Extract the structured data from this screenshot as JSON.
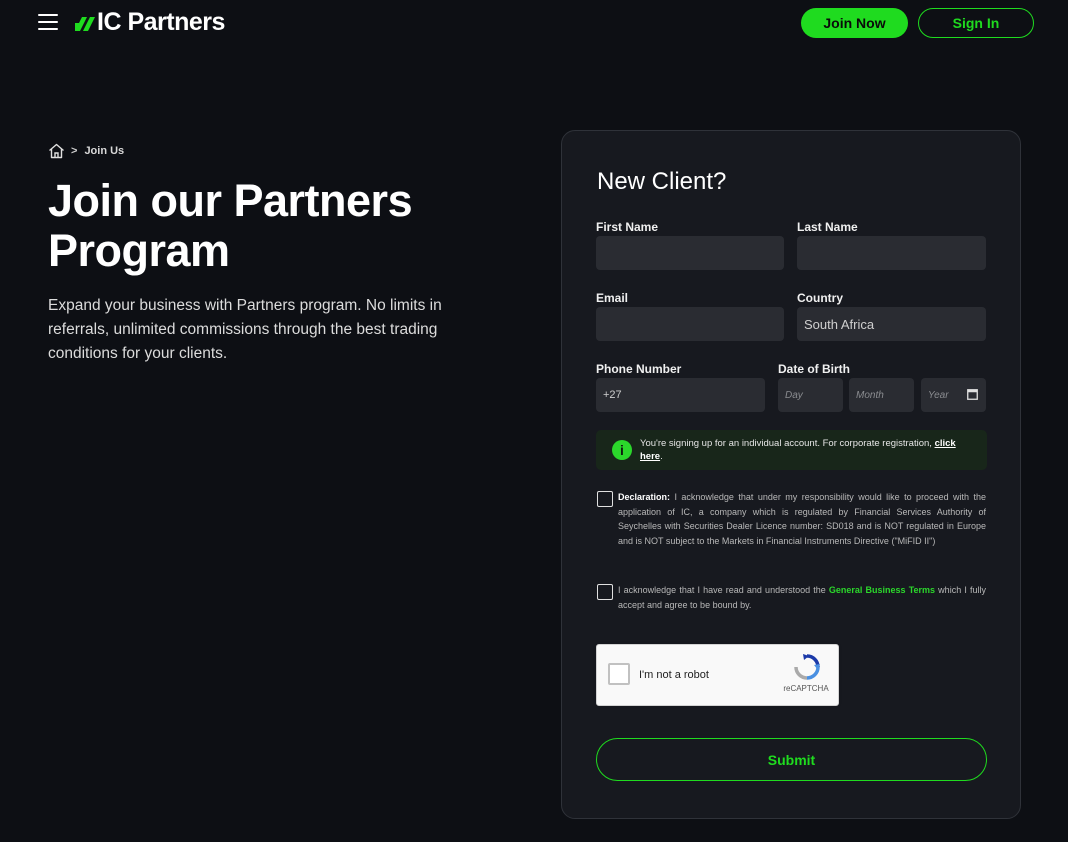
{
  "header": {
    "logo_text": "IC Partners",
    "join_label": "Join Now",
    "signin_label": "Sign In"
  },
  "breadcrumb": {
    "separator": ">",
    "current": "Join Us"
  },
  "hero": {
    "title": "Join our Partners Program",
    "description": "Expand your business with Partners program. No limits in referrals, unlimited commissions through the best trading conditions for your clients."
  },
  "form": {
    "title": "New Client?",
    "first_name_label": "First Name",
    "first_name_value": "",
    "last_name_label": "Last Name",
    "last_name_value": "",
    "email_label": "Email",
    "email_value": "",
    "country_label": "Country",
    "country_value": "South Africa",
    "phone_label": "Phone Number",
    "phone_value": "+27",
    "dob_label": "Date of Birth",
    "day_placeholder": "Day",
    "month_placeholder": "Month",
    "year_placeholder": "Year",
    "info_text": "You're signing up for an individual account. For corporate registration,",
    "info_link": "click here",
    "info_end": ".",
    "declaration_title": "Declaration:",
    "declaration_text": " I acknowledge that under my responsibility would like to proceed with the application of IC, a company which is regulated by Financial Services Authority of Seychelles with Securities Dealer Licence number: SD018 and is NOT regulated in Europe and is NOT subject to the Markets in Financial Instruments Directive (\"MiFID II\")",
    "terms_pre": "I acknowledge that I have read and understood the ",
    "terms_link": "General Business Terms",
    "terms_post": " which I fully accept and agree to be bound by.",
    "recaptcha_label": "I'm not a robot",
    "recaptcha_brand": "reCAPTCHA",
    "submit_label": "Submit"
  },
  "colors": {
    "accent": "#1fdb1f",
    "background": "#0d0f14",
    "card": "#17191f",
    "input": "#2a2c32"
  },
  "icons": [
    "menu-icon",
    "logo-mark",
    "home-icon",
    "info-icon",
    "calendar-icon",
    "recaptcha-logo"
  ]
}
